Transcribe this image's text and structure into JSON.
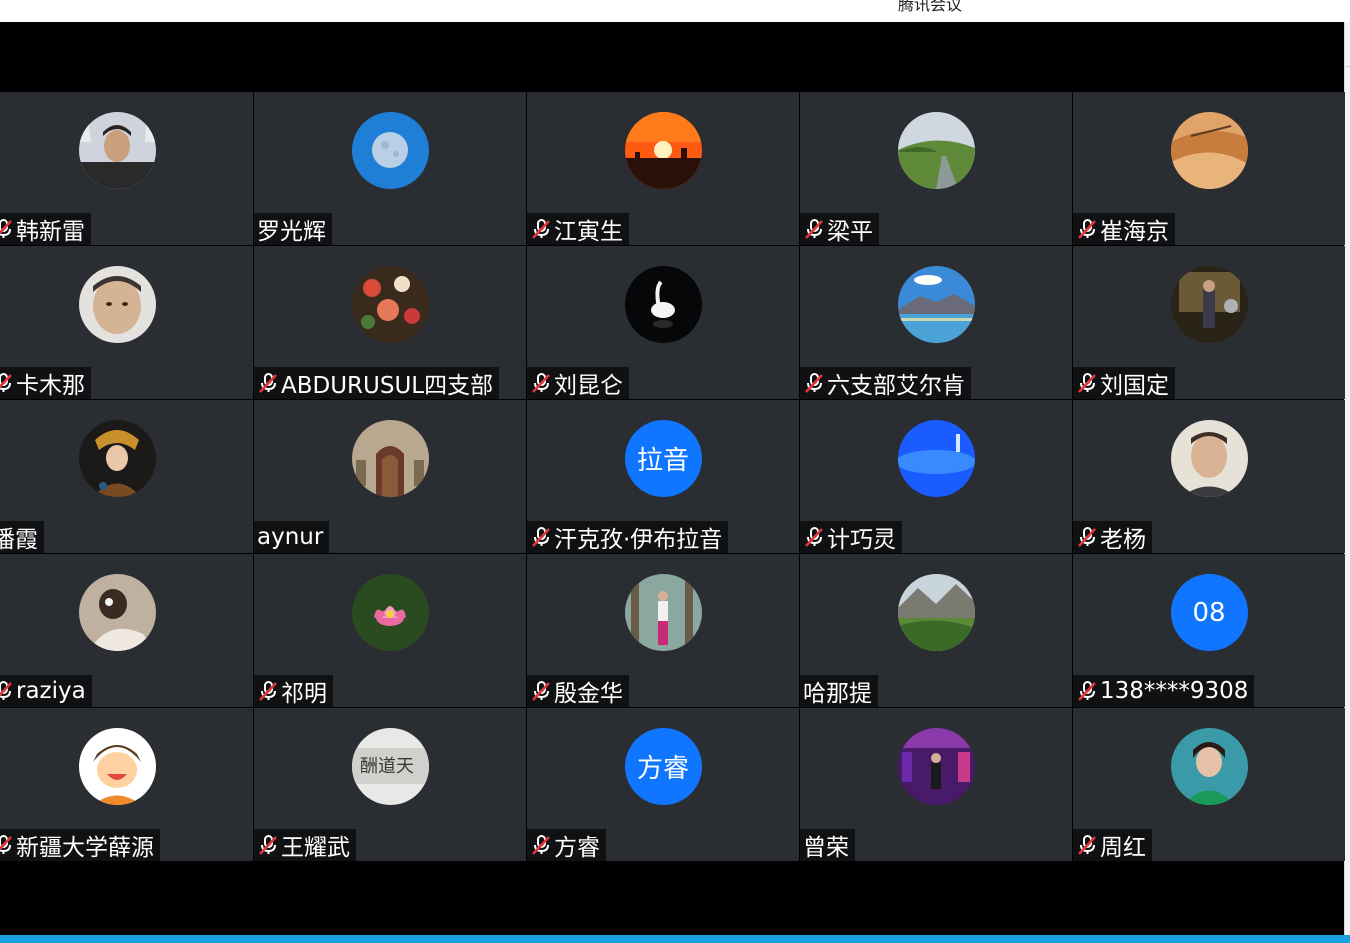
{
  "app": {
    "title": "腾讯会议"
  },
  "participants": [
    {
      "name": "韩新雷",
      "muted": true,
      "avatar": "photo-man-portrait"
    },
    {
      "name": "罗光辉",
      "muted": false,
      "avatar": "photo-moon-blue"
    },
    {
      "name": "江寅生",
      "muted": true,
      "avatar": "photo-sunset"
    },
    {
      "name": "梁平",
      "muted": true,
      "avatar": "photo-green-road"
    },
    {
      "name": "崔海京",
      "muted": true,
      "avatar": "photo-desert-camels"
    },
    {
      "name": "卡木那",
      "muted": true,
      "avatar": "photo-man-face"
    },
    {
      "name": "ABDURUSUL四支部",
      "muted": true,
      "avatar": "photo-flowers"
    },
    {
      "name": "刘昆仑",
      "muted": true,
      "avatar": "photo-swan"
    },
    {
      "name": "六支部艾尔肯",
      "muted": true,
      "avatar": "photo-mountain-lake"
    },
    {
      "name": "刘国定",
      "muted": true,
      "avatar": "photo-person-indoor"
    },
    {
      "name": "潘霞",
      "muted": false,
      "avatar": "photo-woman-costume"
    },
    {
      "name": "aynur",
      "muted": false,
      "avatar": "photo-doorway"
    },
    {
      "name": "汗克孜·伊布拉音",
      "muted": true,
      "avatar": "text",
      "avatar_text": "拉音"
    },
    {
      "name": "计巧灵",
      "muted": true,
      "avatar": "photo-blue-sky"
    },
    {
      "name": "老杨",
      "muted": true,
      "avatar": "photo-older-man"
    },
    {
      "name": "raziya",
      "muted": true,
      "avatar": "photo-woman-back"
    },
    {
      "name": "祁明",
      "muted": true,
      "avatar": "photo-lotus"
    },
    {
      "name": "殷金华",
      "muted": true,
      "avatar": "photo-woman-trees"
    },
    {
      "name": "哈那提",
      "muted": false,
      "avatar": "photo-alpine-valley"
    },
    {
      "name": "138****9308",
      "muted": true,
      "avatar": "text",
      "avatar_text": "08"
    },
    {
      "name": "新疆大学薛源",
      "muted": true,
      "avatar": "photo-cartoon-boy"
    },
    {
      "name": "王耀武",
      "muted": true,
      "avatar": "photo-calligraphy"
    },
    {
      "name": "方睿",
      "muted": true,
      "avatar": "text",
      "avatar_text": "方睿"
    },
    {
      "name": "曾荣",
      "muted": false,
      "avatar": "photo-stage-singer"
    },
    {
      "name": "周红",
      "muted": true,
      "avatar": "photo-woman-green"
    }
  ],
  "colors": {
    "tile_bg": "#2a2d31",
    "nameplate_bg": "#0f1113",
    "text_avatar_bg": "#1075ff",
    "mute_slash": "#e0353b",
    "window_bg": "#000000",
    "taskbar": "#1ba1e2"
  }
}
